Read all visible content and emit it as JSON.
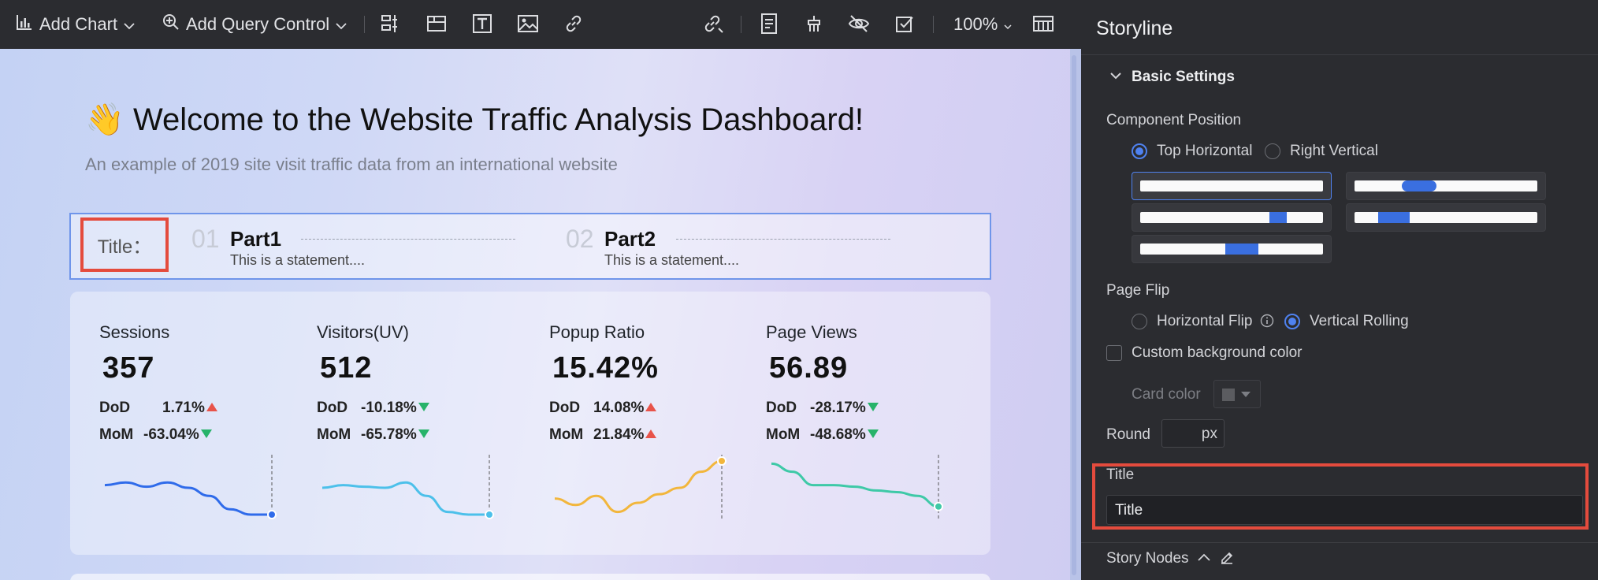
{
  "toolbar": {
    "add_chart": "Add Chart",
    "add_query_control": "Add Query Control",
    "zoom": "100%"
  },
  "dashboard": {
    "welcome_emoji": "👋",
    "welcome_title": "Welcome to the Website Traffic Analysis Dashboard!",
    "subtitle": "An example of 2019 site visit traffic data from an international website",
    "storyline": {
      "title_label": "Title：",
      "nodes": [
        {
          "num": "01",
          "title": "Part1",
          "desc": "This is a statement...."
        },
        {
          "num": "02",
          "title": "Part2",
          "desc": "This is a statement...."
        }
      ]
    },
    "metrics": [
      {
        "label": "Sessions",
        "value": "357",
        "dod_label": "DoD",
        "dod": "1.71%",
        "dod_dir": "up",
        "mom_label": "MoM",
        "mom": "-63.04%",
        "mom_dir": "down",
        "color": "#2f6bea",
        "trend": [
          0.55,
          0.6,
          0.52,
          0.6,
          0.5,
          0.35,
          0.1,
          0.0,
          0.0
        ]
      },
      {
        "label": "Visitors(UV)",
        "value": "512",
        "dod_label": "DoD",
        "dod": "-10.18%",
        "dod_dir": "down",
        "mom_label": "MoM",
        "mom": "-65.78%",
        "mom_dir": "down",
        "color": "#4cc0ea",
        "trend": [
          0.5,
          0.55,
          0.52,
          0.5,
          0.6,
          0.35,
          0.05,
          0.0,
          0.0
        ]
      },
      {
        "label": "Popup Ratio",
        "value": "15.42%",
        "dod_label": "DoD",
        "dod": "14.08%",
        "dod_dir": "up",
        "mom_label": "MoM",
        "mom": "21.84%",
        "mom_dir": "up",
        "color": "#f2b63c",
        "trend": [
          0.3,
          0.18,
          0.35,
          0.05,
          0.22,
          0.38,
          0.5,
          0.8,
          1.0
        ]
      },
      {
        "label": "Page Views",
        "value": "56.89",
        "dod_label": "DoD",
        "dod": "-28.17%",
        "dod_dir": "down",
        "mom_label": "MoM",
        "mom": "-48.68%",
        "mom_dir": "down",
        "color": "#3ec9a7",
        "trend": [
          0.95,
          0.8,
          0.55,
          0.55,
          0.52,
          0.45,
          0.42,
          0.35,
          0.15
        ]
      }
    ]
  },
  "panel": {
    "title": "Storyline",
    "basic_settings": "Basic Settings",
    "component_position": "Component Position",
    "top_horizontal": "Top Horizontal",
    "right_vertical": "Right Vertical",
    "page_flip": "Page Flip",
    "horizontal_flip": "Horizontal Flip",
    "vertical_rolling": "Vertical Rolling",
    "custom_bg": "Custom background color",
    "card_color": "Card color",
    "round": "Round",
    "round_unit": "px",
    "title_label": "Title",
    "title_value": "Title",
    "story_nodes": "Story Nodes"
  }
}
